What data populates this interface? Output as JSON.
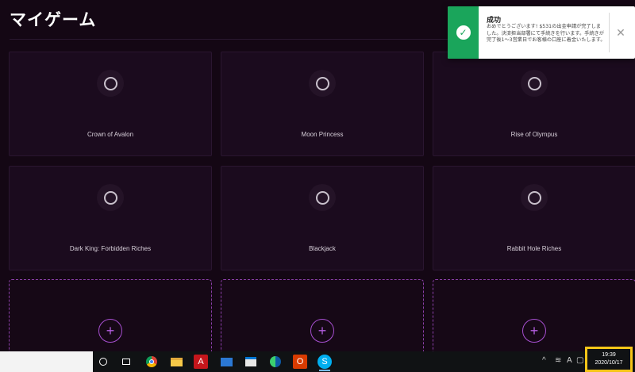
{
  "page": {
    "title": "マイゲーム"
  },
  "games": [
    {
      "name": "Crown of Avalon"
    },
    {
      "name": "Moon Princess"
    },
    {
      "name": "Rise of Olympus"
    },
    {
      "name": "Dark King: Forbidden Riches"
    },
    {
      "name": "Blackjack"
    },
    {
      "name": "Rabbit Hole Riches"
    }
  ],
  "add_slots": [
    {
      "symbol": "+"
    },
    {
      "symbol": "+"
    },
    {
      "symbol": "+"
    }
  ],
  "toast": {
    "title": "成功",
    "message": "おめでとうございます! $531の出金申請が完了しました。決済担当部署にて手続きを行います。手続きが完了後1～3営業日でお客様の口座に着金いたします。",
    "icon": "check-icon",
    "accent_color": "#1aa55b"
  },
  "taskbar": {
    "apps": [
      "cortana-icon",
      "task-view-icon",
      "chrome-icon",
      "file-explorer-icon",
      "acrobat-icon",
      "mail-icon",
      "store-icon",
      "edge-icon",
      "office-icon",
      "skype-icon"
    ],
    "tray": {
      "ime_label": "A"
    },
    "clock": {
      "time": "19:39",
      "date": "2020/10/17"
    },
    "highlight_color": "#f5c518"
  },
  "colors": {
    "background": "#140714",
    "accent": "#a64fd0"
  }
}
